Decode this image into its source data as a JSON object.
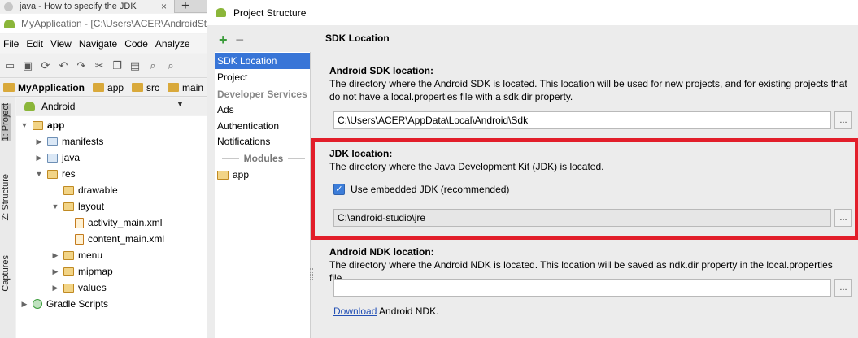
{
  "browser": {
    "tab_title": "java - How to specify the JDK",
    "close": "×",
    "new_tab": "+"
  },
  "ide": {
    "title": "MyApplication - [C:\\Users\\ACER\\AndroidStudioProjects\\MyApplication]",
    "menus": [
      "File",
      "Edit",
      "View",
      "Navigate",
      "Code",
      "Analyze"
    ],
    "breadcrumbs": [
      "MyApplication",
      "app",
      "src",
      "main"
    ],
    "side_tabs": [
      "1: Project",
      "Z: Structure",
      "Captures"
    ],
    "view_selector": "Android",
    "tree": [
      {
        "label": "app",
        "bold": true
      },
      {
        "label": "manifests"
      },
      {
        "label": "java"
      },
      {
        "label": "res"
      },
      {
        "label": "drawable"
      },
      {
        "label": "layout"
      },
      {
        "label": "activity_main.xml"
      },
      {
        "label": "content_main.xml"
      },
      {
        "label": "menu"
      },
      {
        "label": "mipmap"
      },
      {
        "label": "values"
      },
      {
        "label": "Gradle Scripts"
      }
    ]
  },
  "dialog": {
    "title": "Project Structure",
    "nav": {
      "items": [
        "SDK Location",
        "Project",
        "Developer Services",
        "Ads",
        "Authentication",
        "Notifications",
        "Modules",
        "app"
      ]
    },
    "heading": "SDK Location",
    "android_sdk": {
      "title": "Android SDK location:",
      "desc": "The directory where the Android SDK is located. This location will be used for new projects, and for existing projects that do not have a local.properties file with a sdk.dir property.",
      "path": "C:\\Users\\ACER\\AppData\\Local\\Android\\Sdk"
    },
    "jdk": {
      "title": "JDK location:",
      "desc": "The directory where the Java Development Kit (JDK) is located.",
      "checkbox_label": "Use embedded JDK (recommended)",
      "checkbox_checked": true,
      "path": "C:\\android-studio\\jre"
    },
    "ndk": {
      "title": "Android NDK location:",
      "desc": "The directory where the Android NDK is located. This location will be saved as ndk.dir property in the local.properties file.",
      "path": "",
      "link": "Download",
      "link_suffix": " Android NDK."
    },
    "browse_label": "...",
    "highlight_color": "#e21e2a",
    "accent": "#3875d7"
  }
}
